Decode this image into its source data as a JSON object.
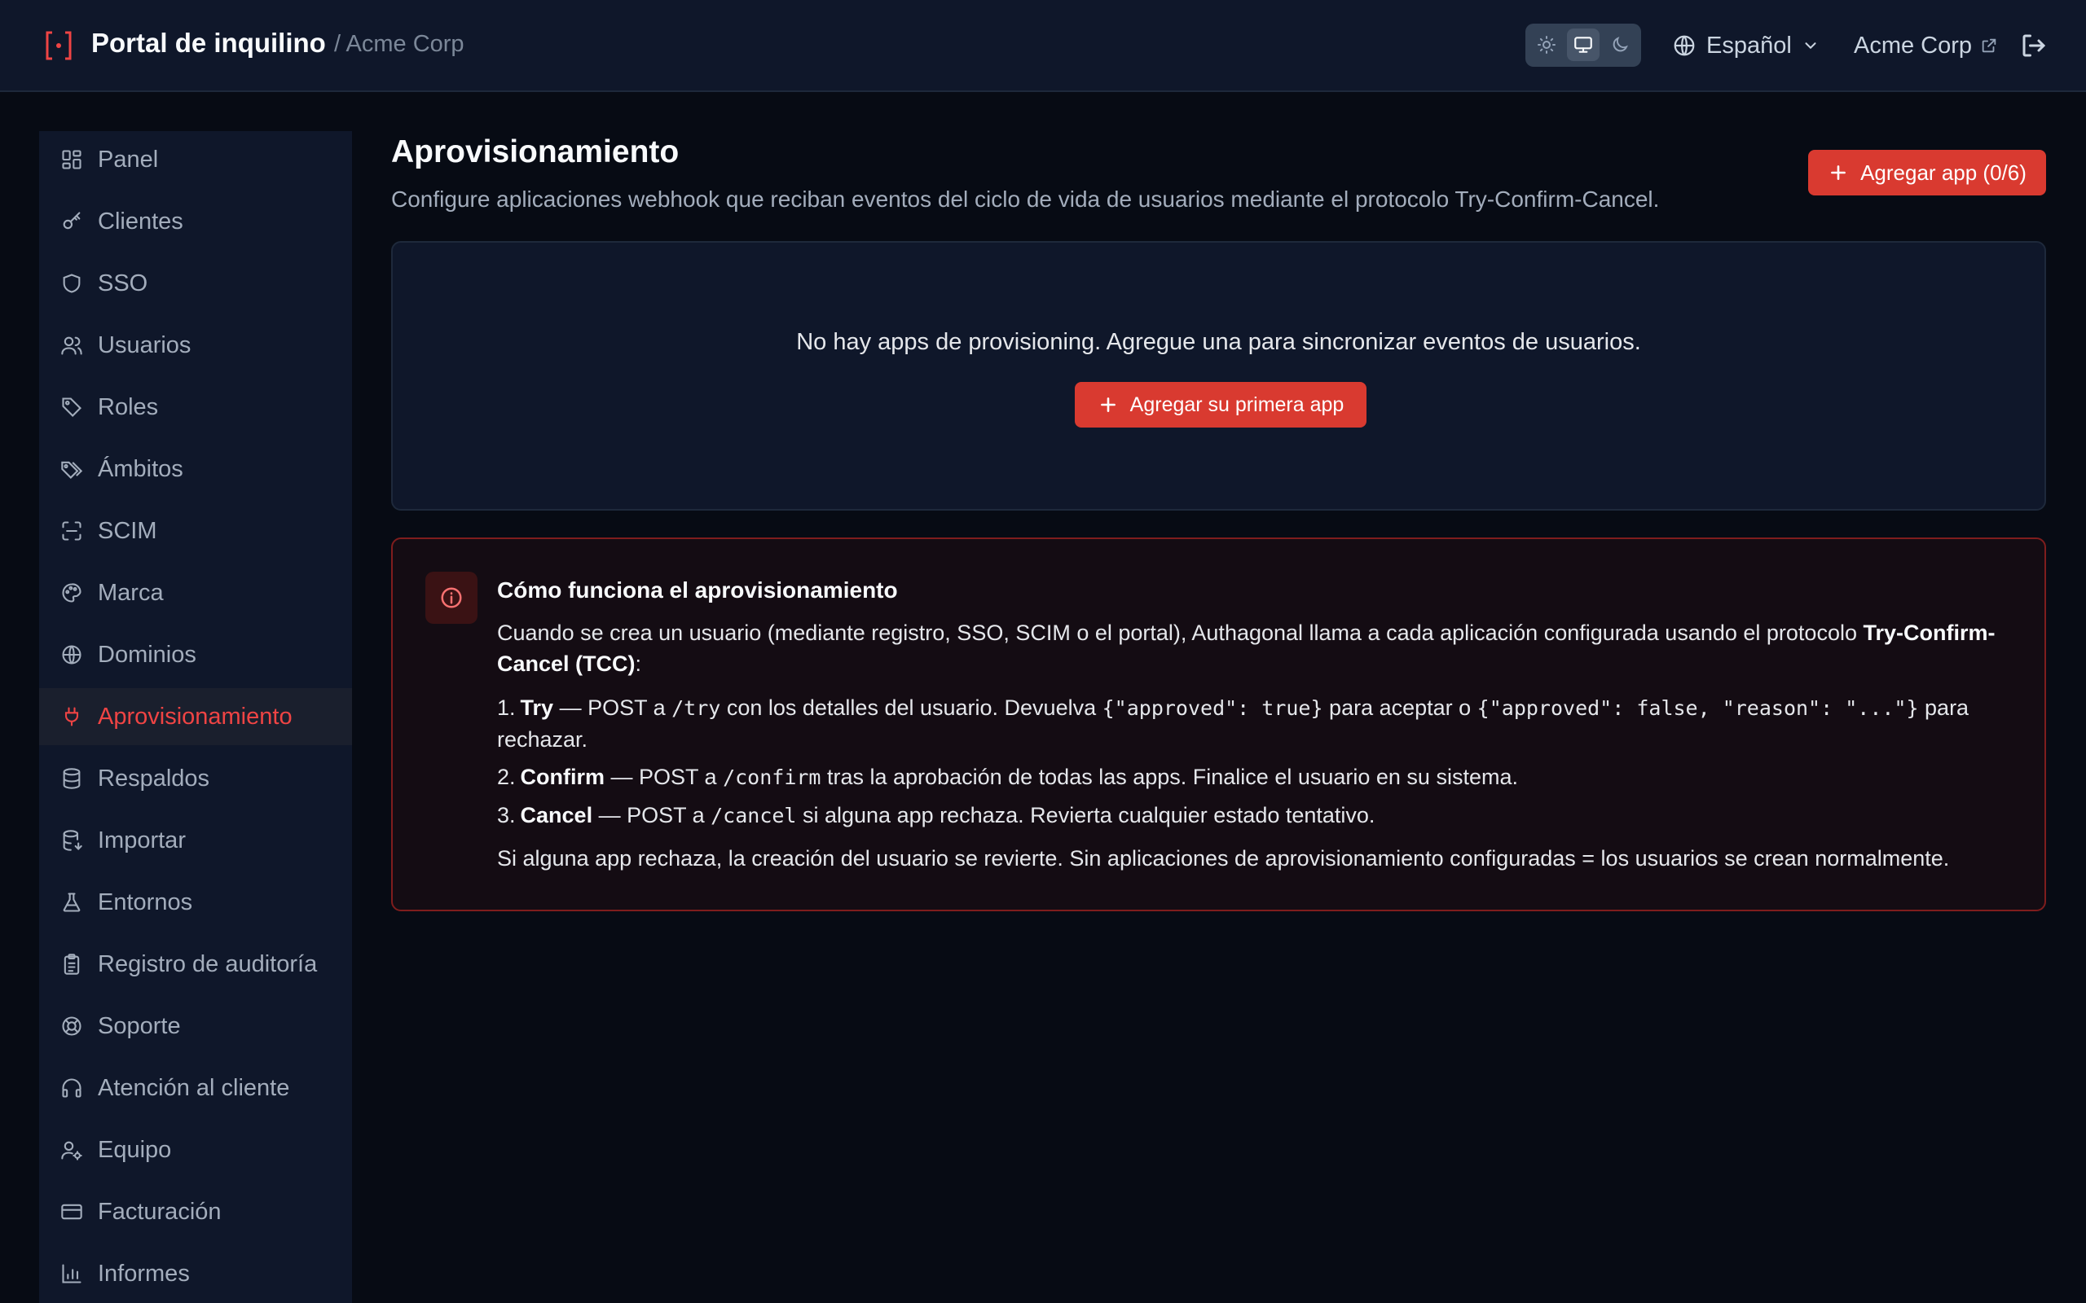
{
  "header": {
    "app_title": "Portal de inquilino",
    "breadcrumb": "/ Acme Corp",
    "language": "Español",
    "org_name": "Acme Corp",
    "theme_modes": [
      "light",
      "system",
      "dark"
    ],
    "active_theme": "system"
  },
  "colors": {
    "accent": "#d93a30",
    "background": "#070b14",
    "panel": "#0f172a"
  },
  "sidebar": {
    "items": [
      {
        "label": "Panel",
        "icon": "dashboard-icon"
      },
      {
        "label": "Clientes",
        "icon": "key-icon"
      },
      {
        "label": "SSO",
        "icon": "shield-icon"
      },
      {
        "label": "Usuarios",
        "icon": "users-icon"
      },
      {
        "label": "Roles",
        "icon": "tag-icon"
      },
      {
        "label": "Ámbitos",
        "icon": "tags-icon"
      },
      {
        "label": "SCIM",
        "icon": "scan-icon"
      },
      {
        "label": "Marca",
        "icon": "palette-icon"
      },
      {
        "label": "Dominios",
        "icon": "globe-icon"
      },
      {
        "label": "Aprovisionamiento",
        "icon": "plug-icon",
        "active": true
      },
      {
        "label": "Respaldos",
        "icon": "database-icon"
      },
      {
        "label": "Importar",
        "icon": "database-import-icon"
      },
      {
        "label": "Entornos",
        "icon": "flask-icon"
      },
      {
        "label": "Registro de auditoría",
        "icon": "clipboard-icon"
      },
      {
        "label": "Soporte",
        "icon": "lifebuoy-icon"
      },
      {
        "label": "Atención al cliente",
        "icon": "headphones-icon"
      },
      {
        "label": "Equipo",
        "icon": "user-cog-icon"
      },
      {
        "label": "Facturación",
        "icon": "credit-card-icon"
      },
      {
        "label": "Informes",
        "icon": "bar-chart-icon"
      }
    ]
  },
  "main": {
    "title": "Aprovisionamiento",
    "description": "Configure aplicaciones webhook que reciban eventos del ciclo de vida de usuarios mediante el protocolo Try-Confirm-Cancel.",
    "add_button": "Agregar app (0/6)",
    "empty_state": {
      "message": "No hay apps de provisioning. Agregue una para sincronizar eventos de usuarios.",
      "button": "Agregar su primera app"
    },
    "info": {
      "title": "Cómo funciona el aprovisionamiento",
      "intro_pre": "Cuando se crea un usuario (mediante registro, SSO, SCIM o el portal), Authagonal llama a cada aplicación configurada usando el protocolo ",
      "intro_bold": "Try-Confirm-Cancel (TCC)",
      "intro_post": ":",
      "steps": [
        {
          "num": "1.",
          "name": "Try",
          "pre": " — POST a ",
          "code": "/try",
          "mid": " con los detalles del usuario. Devuelva ",
          "code2": "{\"approved\": true}",
          "mid2": " para aceptar o ",
          "code3": "{\"approved\": false, \"reason\": \"...\"}",
          "post": " para rechazar."
        },
        {
          "num": "2.",
          "name": "Confirm",
          "pre": " — POST a ",
          "code": "/confirm",
          "post": " tras la aprobación de todas las apps. Finalice el usuario en su sistema."
        },
        {
          "num": "3.",
          "name": "Cancel",
          "pre": " — POST a ",
          "code": "/cancel",
          "post": " si alguna app rechaza. Revierta cualquier estado tentativo."
        }
      ],
      "footer": "Si alguna app rechaza, la creación del usuario se revierte. Sin aplicaciones de aprovisionamiento configuradas = los usuarios se crean normalmente."
    }
  }
}
